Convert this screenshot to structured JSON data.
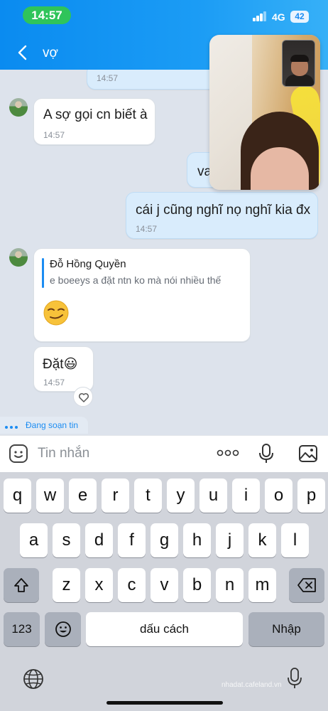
{
  "status_bar": {
    "time": "14:57",
    "network": "4G",
    "battery": "42"
  },
  "header": {
    "title": "vợ"
  },
  "messages": [
    {
      "id": "m0",
      "time": "14:57"
    },
    {
      "id": "m1",
      "text": "A sợ gọi cn biết à",
      "time": "14:57"
    },
    {
      "id": "m2",
      "text": "va"
    },
    {
      "id": "m3",
      "text": "cái j cũng nghĩ nọ nghĩ kia đx",
      "time": "14:57"
    },
    {
      "id": "m4",
      "quote_author": "Đỗ Hồng Quyền",
      "quote_text": "e boeeys a đặt ntn ko mà nói nhiều thế",
      "emoji": "smirk"
    },
    {
      "id": "m5",
      "text": "Đặt😃",
      "time": "14:57"
    }
  ],
  "typing_indicator": "Đang soạn tin",
  "input": {
    "placeholder": "Tin nhắn"
  },
  "keyboard": {
    "row1": [
      "q",
      "w",
      "e",
      "r",
      "t",
      "y",
      "u",
      "i",
      "o",
      "p"
    ],
    "row2": [
      "a",
      "s",
      "d",
      "f",
      "g",
      "h",
      "j",
      "k",
      "l"
    ],
    "row3": [
      "z",
      "x",
      "c",
      "v",
      "b",
      "n",
      "m"
    ],
    "numbers_key": "123",
    "space_key": "dấu cách",
    "return_key": "Nhập"
  },
  "watermark": "nhadat.cafeland.vn",
  "colors": {
    "accent": "#1b8cf2",
    "outgoing_bubble": "#d9ecfc",
    "status_pill": "#2fc45a"
  }
}
